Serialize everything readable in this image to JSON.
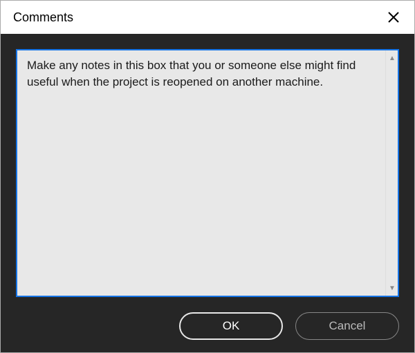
{
  "dialog": {
    "title": "Comments",
    "textarea_value": "Make any notes in this box that you or someone else might find useful when the project is reopened on another machine.",
    "buttons": {
      "ok_label": "OK",
      "cancel_label": "Cancel"
    }
  }
}
